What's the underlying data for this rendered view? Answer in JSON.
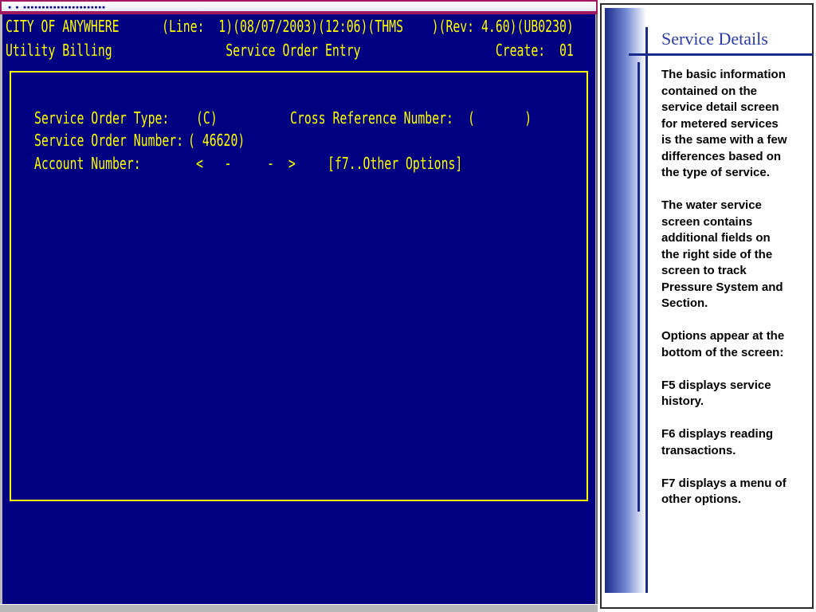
{
  "terminal": {
    "titlebar_text": "▪ ▪ ▪▪▪▪▪▪▪▪▪▪▪▪▪▪▪▪▪▪▪▪▪▪",
    "header_line_1": "CITY OF ANYWHERE      (Line:  1)(08/07/2003)(12:06)(THMS    )(Rev: 4.60)(UB0230)",
    "header_line_2": "Utility Billing                Service Order Entry                   Create:  01",
    "form": {
      "order_type_label": "Service Order Type:",
      "order_type_value": "(C)",
      "cross_ref_label": "Cross Reference Number:",
      "cross_ref_value": "(       )",
      "order_number_label": "Service Order Number:",
      "order_number_value": "( 46620)",
      "account_label": "Account Number:",
      "account_value": "<   -     -  >",
      "other_options": "[f7..Other Options]"
    },
    "colors": {
      "screen_bg": "#000080",
      "text": "#ffff00",
      "frame": "#b8b8b8"
    }
  },
  "notes": {
    "title": "Service Details",
    "paragraphs": [
      "The basic information contained on the service detail screen for metered services is the same with a few differences based on the type of service.",
      "The water service screen contains additional fields on the right side of the screen to track Pressure System and Section.",
      "Options appear at the bottom of the screen:",
      "F5 displays service history.",
      "F6 displays reading transactions.",
      "F7 displays a menu of other options."
    ],
    "colors": {
      "title": "#2b3ba8",
      "accent": "#1a2a8a"
    }
  }
}
